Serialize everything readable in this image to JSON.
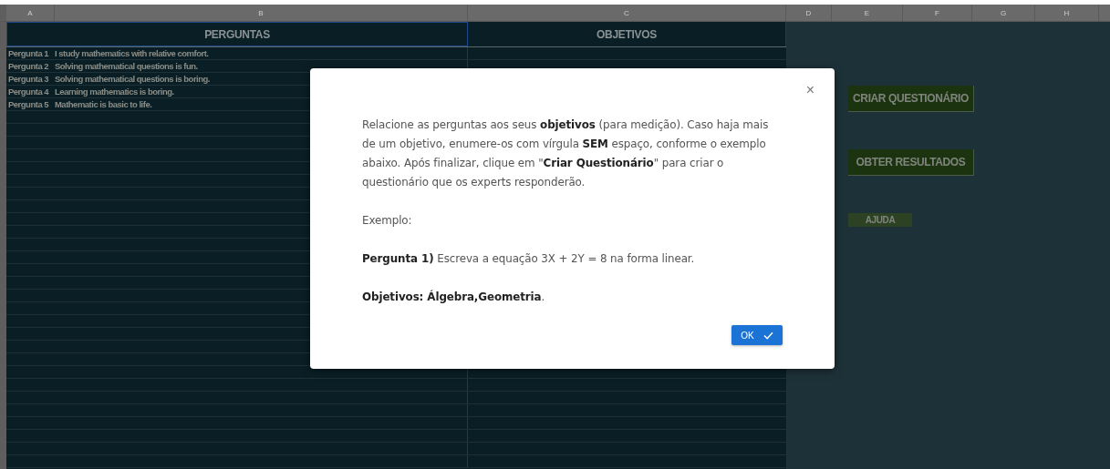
{
  "column_headers": [
    "A",
    "B",
    "C",
    "D",
    "E",
    "F",
    "G",
    "H"
  ],
  "table": {
    "headers": [
      {
        "text": "PERGUNTAS",
        "selected": true
      },
      {
        "text": "OBJETIVOS",
        "selected": false
      }
    ],
    "rows": [
      {
        "label": "Pergunta 1",
        "question": "I study mathematics with relative comfort."
      },
      {
        "label": "Pergunta 2",
        "question": "Solving mathematical questions is fun."
      },
      {
        "label": "Pergunta 3",
        "question": "Solving mathematical questions is boring."
      },
      {
        "label": "Pergunta 4",
        "question": "Learning mathematics is boring."
      },
      {
        "label": "Pergunta 5",
        "question": "Mathematic is basic to life."
      }
    ]
  },
  "sheet_buttons": [
    {
      "label": "CRIAR QUESTIONÁRIO",
      "kind": "large"
    },
    {
      "label": "OBTER RESULTADOS",
      "kind": "large"
    },
    {
      "label": "AJUDA",
      "kind": "small"
    }
  ],
  "dialog": {
    "close": "×",
    "paragraphs": [
      "Relacione as perguntas aos seus **objetivos** (para medição). Caso haja mais de um objetivo, enumere-os com vírgula **SEM** espaço, conforme o exemplo abaixo. Após finalizar, clique em \"**Criar Questionário**\" para criar o questionário que os experts responderão.",
      "Exemplo:",
      "**Pergunta 1)** Escreva a equação 3X + 2Y = 8 na forma linear.",
      "**Objetivos: Álgebra,Geometria**."
    ],
    "ok_button": "OK"
  }
}
